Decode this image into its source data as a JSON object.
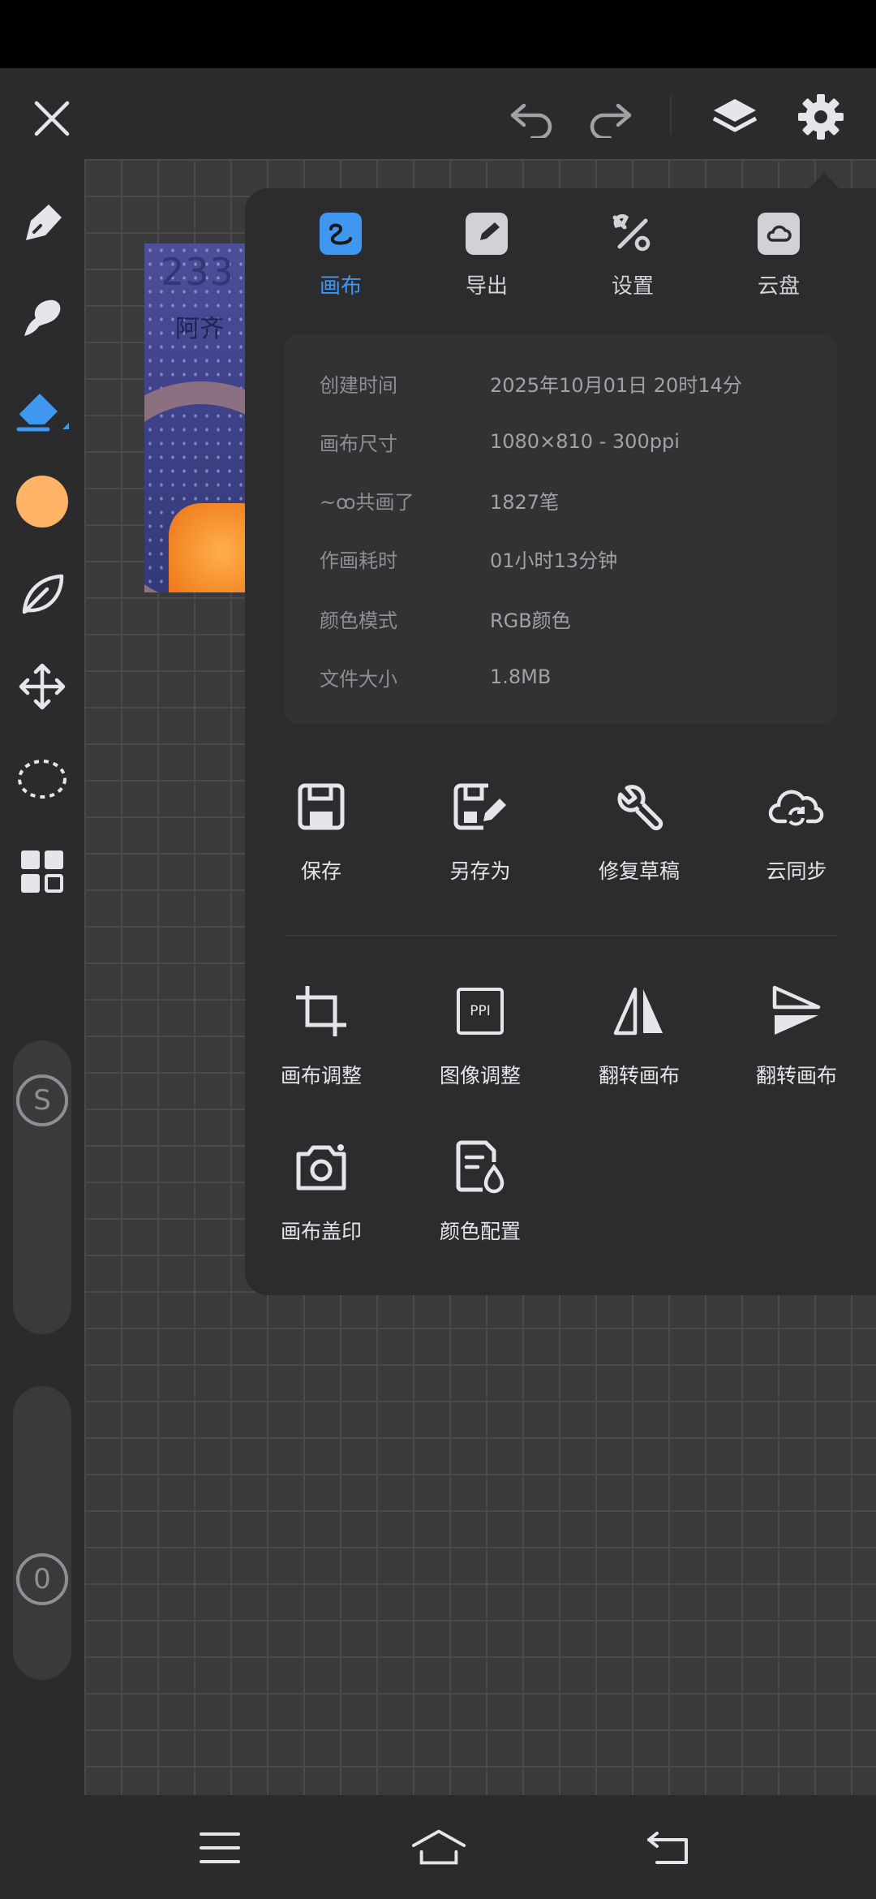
{
  "topbar": {
    "close_icon": "close-icon",
    "undo_icon": "undo-icon",
    "redo_icon": "redo-icon",
    "layers_icon": "layers-icon",
    "settings_icon": "gear-icon"
  },
  "sidebar": {
    "tools": [
      "pen",
      "smudge",
      "eraser",
      "color",
      "leaf",
      "move",
      "lasso",
      "grid"
    ],
    "color_swatch": "#ffb366",
    "accent": "#3f97f0",
    "size_slider_label": "S",
    "opacity_slider_label": "0"
  },
  "artwork": {
    "text_top": "233",
    "text_bottom": "阿齐"
  },
  "panel": {
    "tabs": [
      {
        "label": "画布",
        "icon": "canvas-icon",
        "active": true
      },
      {
        "label": "导出",
        "icon": "export-icon",
        "active": false
      },
      {
        "label": "设置",
        "icon": "tools-icon",
        "active": false
      },
      {
        "label": "云盘",
        "icon": "cloud-drive-icon",
        "active": false
      }
    ],
    "info": [
      {
        "key": "创建时间",
        "value": "2025年10月01日  20时14分"
      },
      {
        "key": "画布尺寸",
        "value": "1080×810 - 300ppi"
      },
      {
        "key": "~ꝏ共画了",
        "value": "1827笔"
      },
      {
        "key": "作画耗时",
        "value": "01小时13分钟"
      },
      {
        "key": "颜色模式",
        "value": "RGB颜色"
      },
      {
        "key": "文件大小",
        "value": "1.8MB"
      }
    ],
    "actions_row1": [
      {
        "label": "保存",
        "icon": "save-icon"
      },
      {
        "label": "另存为",
        "icon": "save-as-icon"
      },
      {
        "label": "修复草稿",
        "icon": "wrench-icon"
      },
      {
        "label": "云同步",
        "icon": "cloud-sync-icon"
      }
    ],
    "actions_row2": [
      {
        "label": "画布调整",
        "icon": "crop-icon"
      },
      {
        "label": "图像调整",
        "icon": "ppi-icon",
        "badge": "PPI"
      },
      {
        "label": "翻转画布",
        "icon": "flip-horizontal-icon"
      },
      {
        "label": "翻转画布",
        "icon": "flip-vertical-icon"
      }
    ],
    "actions_row3": [
      {
        "label": "画布盖印",
        "icon": "camera-icon"
      },
      {
        "label": "颜色配置",
        "icon": "color-profile-icon"
      }
    ]
  },
  "navbar": {
    "menu_icon": "menu-icon",
    "home_icon": "home-icon",
    "back_icon": "back-icon"
  }
}
